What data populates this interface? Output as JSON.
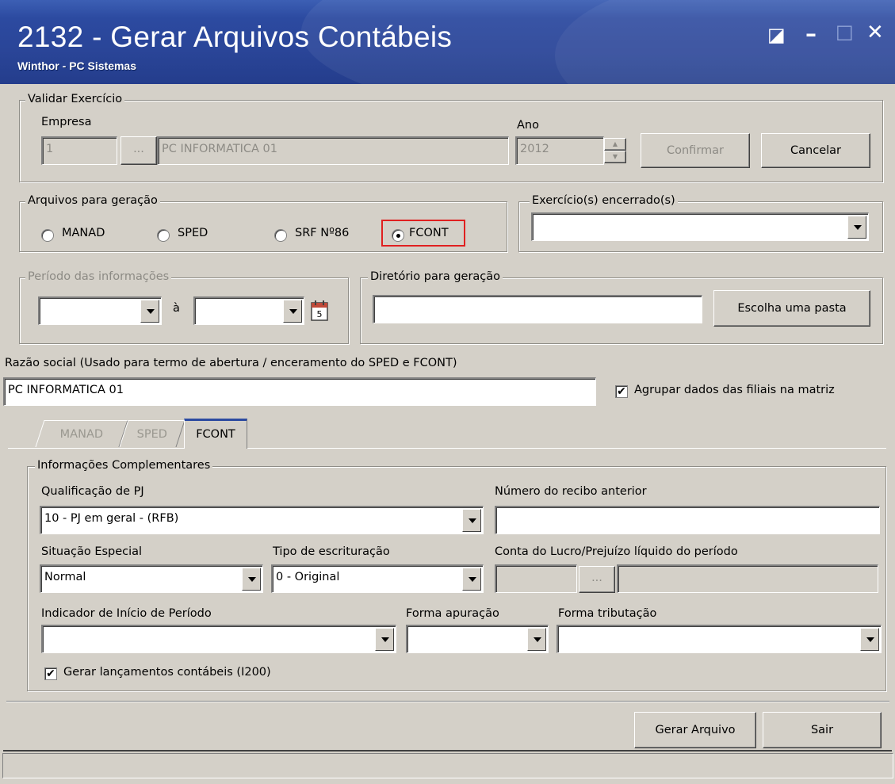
{
  "window": {
    "title": "2132 - Gerar Arquivos Contábeis",
    "subtitle": "Winthor - PC Sistemas",
    "controls": {
      "restore": "◪",
      "minimize": "–",
      "maximize": "□",
      "close": "✕"
    }
  },
  "validar": {
    "legend": "Validar Exercício",
    "empresa_label": "Empresa",
    "empresa_code": "1",
    "lookup_btn": "...",
    "empresa_name": "PC INFORMATICA 01",
    "ano_label": "Ano",
    "ano_value": "2012",
    "confirmar_btn": "Confirmar",
    "cancelar_btn": "Cancelar"
  },
  "arquivos": {
    "legend": "Arquivos para geração",
    "options": [
      "MANAD",
      "SPED",
      "SRF Nº86",
      "FCONT"
    ],
    "selected": "FCONT",
    "highlight_color": "#e02020"
  },
  "exercicios": {
    "legend": "Exercício(s) encerrado(s)",
    "value": ""
  },
  "periodo": {
    "legend": "Período das informações",
    "separator": "à",
    "start": "",
    "end": ""
  },
  "diretorio": {
    "legend": "Diretório para geração",
    "value": "",
    "choose_btn": "Escolha uma pasta"
  },
  "razao": {
    "label": "Razão social (Usado para termo de abertura / enceramento do SPED e FCONT)",
    "value": "PC INFORMATICA 01",
    "agrupar_label": "Agrupar dados das filiais na matriz",
    "agrupar_checked": true
  },
  "tabs": [
    {
      "label": "MANAD",
      "active": false
    },
    {
      "label": "SPED",
      "active": false
    },
    {
      "label": "FCONT",
      "active": true
    }
  ],
  "info": {
    "legend": "Informações Complementares",
    "qualificacao_label": "Qualificação de PJ",
    "qualificacao_value": "10 - PJ em geral - (RFB)",
    "recibo_label": "Número do recibo anterior",
    "recibo_value": "",
    "situacao_label": "Situação Especial",
    "situacao_value": "Normal",
    "tipo_label": "Tipo de escrituração",
    "tipo_value": "0 - Original",
    "conta_label": "Conta do Lucro/Prejuízo líquido do período",
    "conta_code": "",
    "conta_btn": "...",
    "conta_desc": "",
    "indicador_label": "Indicador de Início de Período",
    "indicador_value": "",
    "apuracao_label": "Forma apuração",
    "apuracao_value": "",
    "tributacao_label": "Forma tributação",
    "tributacao_value": "",
    "gerar_lanc_label": "Gerar lançamentos contábeis (I200)",
    "gerar_lanc_checked": true
  },
  "footer": {
    "gerar_btn": "Gerar Arquivo",
    "sair_btn": "Sair"
  }
}
